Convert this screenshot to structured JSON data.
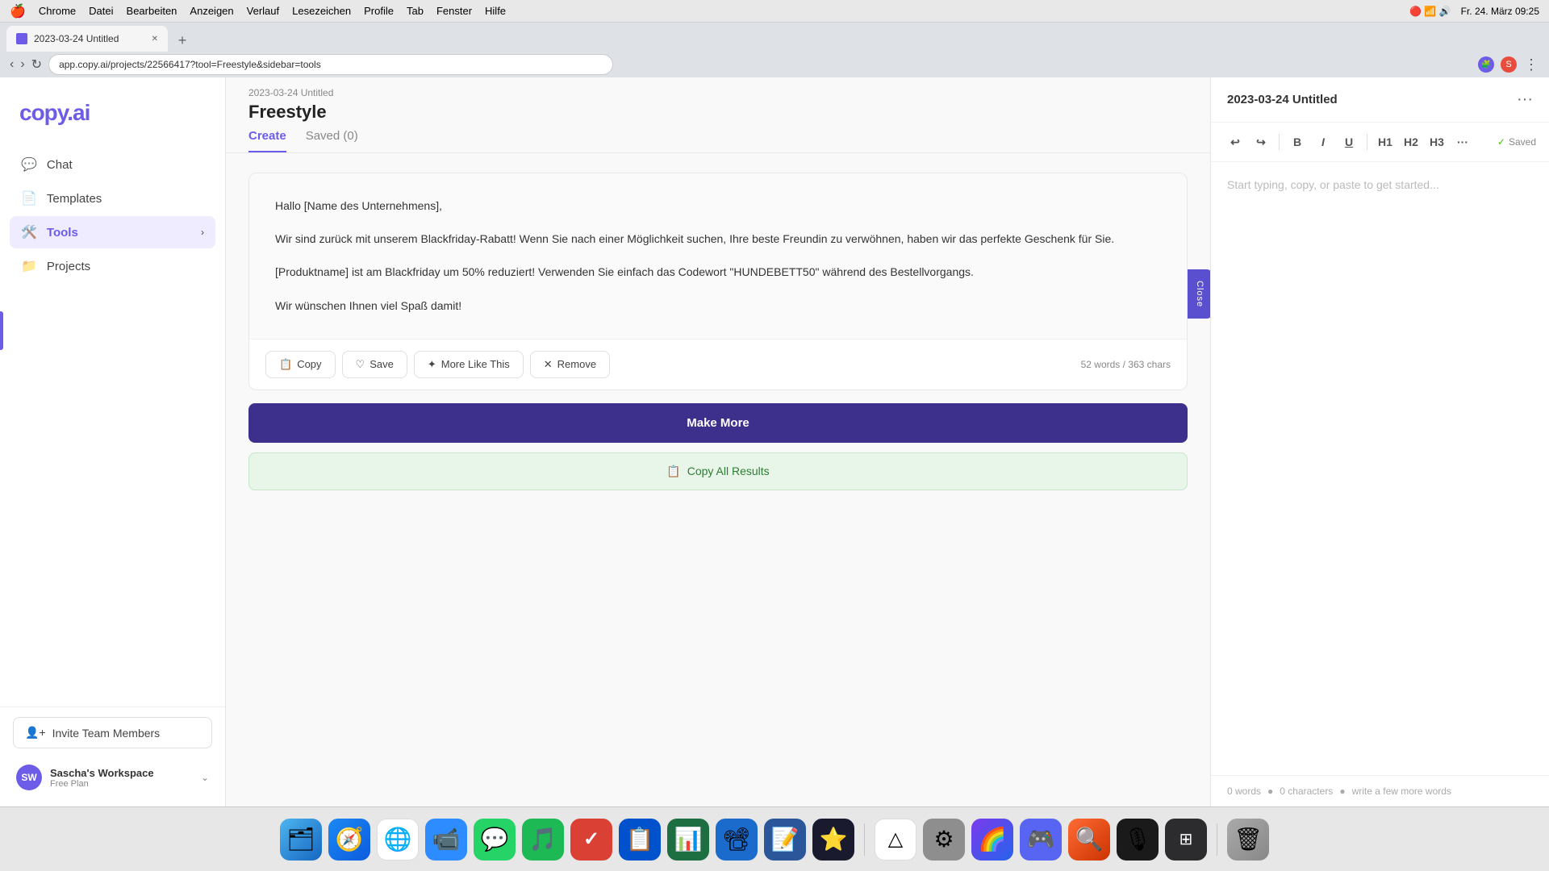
{
  "macbar": {
    "apple": "🍎",
    "menus": [
      "Chrome",
      "Datei",
      "Bearbeiten",
      "Anzeigen",
      "Verlauf",
      "Lesezeichen",
      "Profile",
      "Tab",
      "Fenster",
      "Hilfe"
    ],
    "date": "Fr. 24. März  09:25"
  },
  "browser": {
    "tab_title": "2023-03-24 Untitled",
    "url": "app.copy.ai/projects/22566417?tool=Freestyle&sidebar=tools",
    "tab_new": "+"
  },
  "sidebar": {
    "logo": "copy.ai",
    "nav": [
      {
        "id": "chat",
        "label": "Chat",
        "icon": "💬"
      },
      {
        "id": "templates",
        "label": "Templates",
        "icon": "📄"
      },
      {
        "id": "tools",
        "label": "Tools",
        "icon": "🛠️",
        "active": true,
        "has_chevron": true
      },
      {
        "id": "projects",
        "label": "Projects",
        "icon": "📁"
      }
    ],
    "invite_btn": "Invite Team Members",
    "workspace": {
      "initials": "SW",
      "name": "Sascha's Workspace",
      "plan": "Free Plan"
    }
  },
  "main": {
    "breadcrumb": "2023-03-24 Untitled",
    "title": "Freestyle",
    "tabs": [
      {
        "id": "create",
        "label": "Create",
        "active": true
      },
      {
        "id": "saved",
        "label": "Saved (0)",
        "active": false
      }
    ],
    "result": {
      "text_line1": "Hallo [Name des Unternehmens],",
      "text_line2": "Wir sind zurück mit unserem Blackfriday-Rabatt! Wenn Sie nach einer Möglichkeit suchen, Ihre beste Freundin zu verwöhnen, haben wir das perfekte Geschenk für Sie.",
      "text_line3": "[Produktname] ist am Blackfriday um 50% reduziert! Verwenden Sie einfach das Codewort \"HUNDEBETT50\" während des Bestellvorgangs.",
      "text_line4": "Wir wünschen Ihnen viel Spaß damit!",
      "word_count": "52 words / 363 chars"
    },
    "actions": {
      "copy": "Copy",
      "save": "Save",
      "more_like_this": "More Like This",
      "remove": "Remove"
    },
    "close_tab": "Close",
    "make_more": "Make More",
    "copy_all": "Copy All Results"
  },
  "panel": {
    "title": "2023-03-24 Untitled",
    "placeholder": "Start typing, copy, or paste to get started...",
    "toolbar": {
      "undo": "↩",
      "redo": "↪",
      "bold": "B",
      "italic": "I",
      "underline": "U",
      "h1": "H1",
      "h2": "H2",
      "h3": "H3",
      "more": "...",
      "saved": "Saved"
    },
    "footer": {
      "words": "0 words",
      "chars": "0 characters",
      "hint": "write a few more words"
    }
  },
  "dock": {
    "apps": [
      {
        "id": "finder",
        "emoji": "🗂",
        "color": "#4db6f0"
      },
      {
        "id": "safari",
        "emoji": "🧭",
        "color": "#1b89f4"
      },
      {
        "id": "chrome",
        "emoji": "🌐",
        "color": "#fff"
      },
      {
        "id": "zoom",
        "emoji": "📹",
        "color": "#2d8cff"
      },
      {
        "id": "whatsapp",
        "emoji": "💬",
        "color": "#25d366"
      },
      {
        "id": "spotify",
        "emoji": "🎵",
        "color": "#1db954"
      },
      {
        "id": "todoist",
        "emoji": "✓",
        "color": "#db4035"
      },
      {
        "id": "trello",
        "emoji": "🟦",
        "color": "#0052cc"
      },
      {
        "id": "excel",
        "emoji": "📊",
        "color": "#1d6f42"
      },
      {
        "id": "keynote",
        "emoji": "📽",
        "color": "#1b6bcd"
      },
      {
        "id": "word",
        "emoji": "📝",
        "color": "#2b579a"
      },
      {
        "id": "notchmeister",
        "emoji": "⭐",
        "color": "#1a1a2e"
      },
      {
        "id": "gdrive",
        "emoji": "△",
        "color": "#fff"
      },
      {
        "id": "settings",
        "emoji": "⚙",
        "color": "#8e8e8e"
      },
      {
        "id": "arc",
        "emoji": "🌈",
        "color": "#7c3aed"
      },
      {
        "id": "discord",
        "emoji": "🎮",
        "color": "#5865f2"
      },
      {
        "id": "alfred",
        "emoji": "🔍",
        "color": "#ff6b35"
      },
      {
        "id": "soundwave",
        "emoji": "🎙",
        "color": "#1a1a1a"
      },
      {
        "id": "mission",
        "emoji": "⊞",
        "color": "#2c2c2e"
      },
      {
        "id": "trash",
        "emoji": "🗑",
        "color": "#aaa"
      }
    ]
  }
}
